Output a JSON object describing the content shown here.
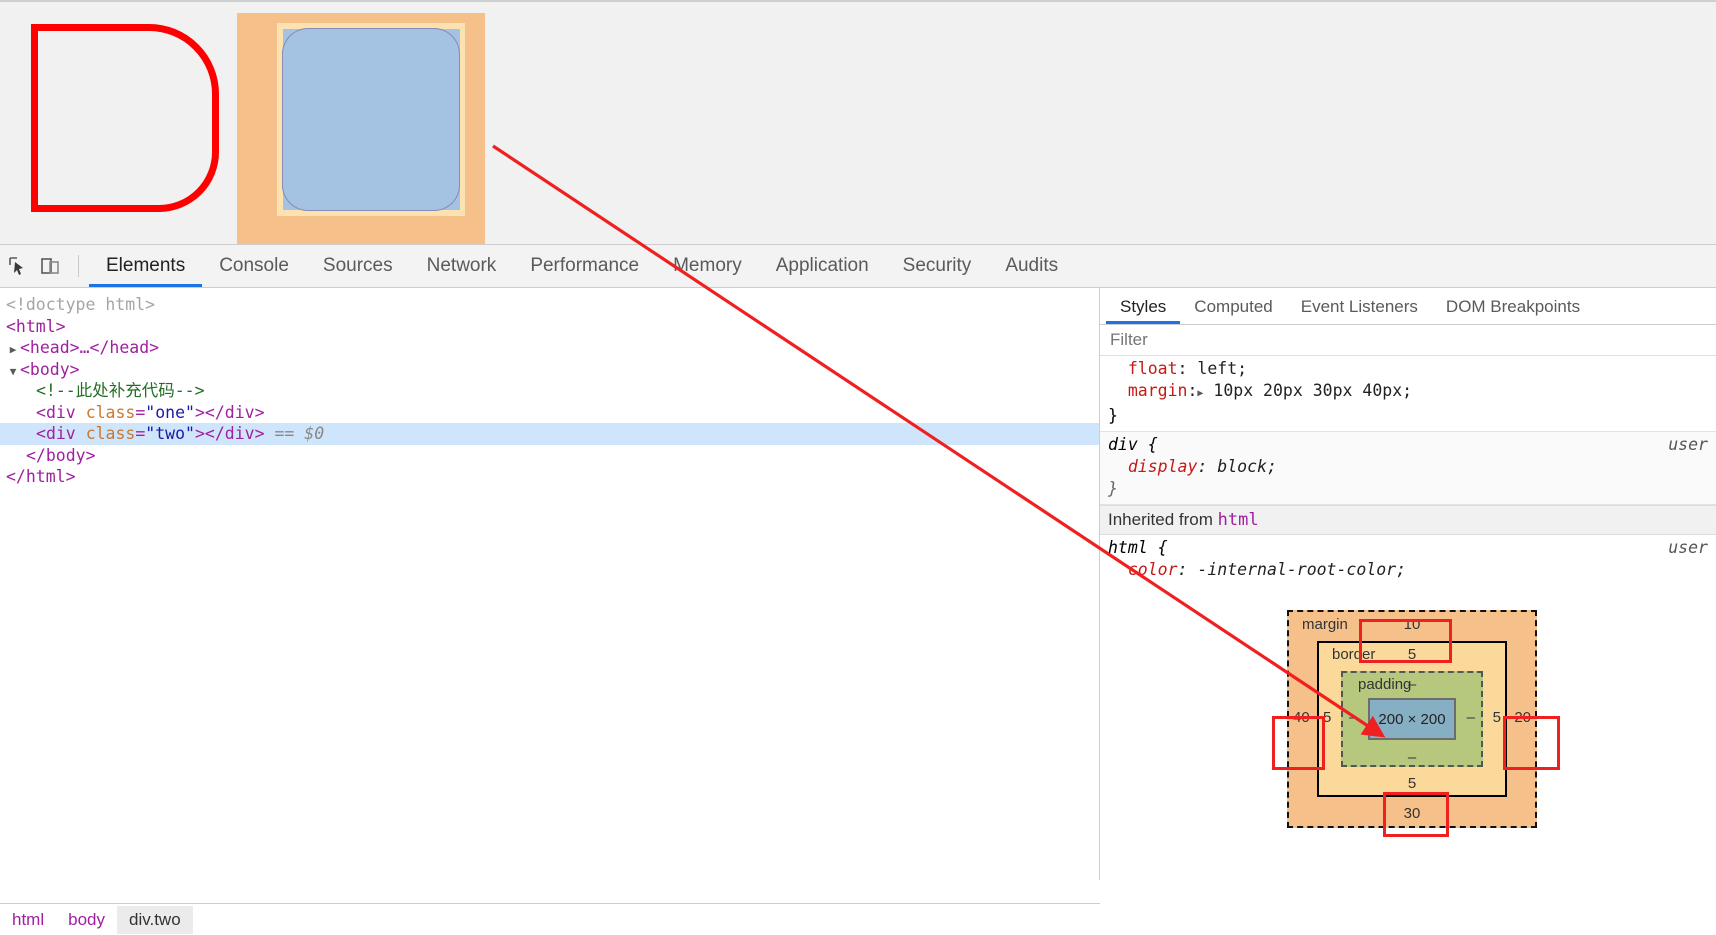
{
  "viewport": {
    "boxes": [
      {
        "name": "div-one-outline",
        "desc": "red hand-drawn rounded rectangle"
      },
      {
        "name": "div-two-highlight",
        "desc": "devtools element highlight with margin/border/padding/content overlay"
      }
    ]
  },
  "toolbar": {
    "icons": [
      {
        "name": "inspect-element-icon",
        "glyph": "⬉"
      },
      {
        "name": "device-toolbar-icon",
        "glyph": "▭"
      }
    ],
    "tabs": [
      {
        "label": "Elements",
        "active": true
      },
      {
        "label": "Console",
        "active": false
      },
      {
        "label": "Sources",
        "active": false
      },
      {
        "label": "Network",
        "active": false
      },
      {
        "label": "Performance",
        "active": false
      },
      {
        "label": "Memory",
        "active": false
      },
      {
        "label": "Application",
        "active": false
      },
      {
        "label": "Security",
        "active": false
      },
      {
        "label": "Audits",
        "active": false
      }
    ]
  },
  "dom": {
    "lines": [
      {
        "id": "doctype",
        "text": "<!doctype html>"
      },
      {
        "id": "html_open",
        "text": "<html>"
      },
      {
        "id": "head",
        "text": "<head>…</head>"
      },
      {
        "id": "body_open",
        "text": "<body>"
      },
      {
        "id": "comment",
        "text": "<!--此处补充代码-->"
      },
      {
        "id": "div_one",
        "tag": "div",
        "attr": "class",
        "value": "one"
      },
      {
        "id": "div_two",
        "tag": "div",
        "attr": "class",
        "value": "two",
        "marker": "== $0",
        "selected": true
      },
      {
        "id": "body_close",
        "text": "</body>"
      },
      {
        "id": "html_close",
        "text": "</html>"
      }
    ]
  },
  "styles": {
    "tabs": [
      {
        "label": "Styles",
        "active": true
      },
      {
        "label": "Computed",
        "active": false
      },
      {
        "label": "Event Listeners",
        "active": false
      },
      {
        "label": "DOM Breakpoints",
        "active": false
      }
    ],
    "filter_placeholder": "Filter",
    "rules": [
      {
        "id": "truncated-rule",
        "selector": "",
        "origin": "",
        "declarations": [
          {
            "property": "float",
            "value": "left;"
          },
          {
            "property": "margin",
            "value": "10px 20px 30px 40px;",
            "has_expander": true
          }
        ],
        "close": "}"
      },
      {
        "id": "div-rule",
        "selector": "div {",
        "origin": "user",
        "declarations": [
          {
            "property": "display",
            "value": "block;"
          }
        ],
        "close": "}"
      }
    ],
    "inherited_label": "Inherited from",
    "inherited_from": "html",
    "inherited_rule": {
      "selector": "html {",
      "origin": "user",
      "declarations": [
        {
          "property": "color",
          "value": "-internal-root-color;"
        }
      ],
      "close": "}"
    }
  },
  "box_model": {
    "margin_label": "margin",
    "border_label": "border",
    "padding_label": "padding",
    "content_size": "200 × 200",
    "margin_top": "10",
    "margin_right": "20",
    "margin_bottom": "30",
    "margin_left": "40",
    "border_top": "5",
    "border_right": "5",
    "border_bottom": "5",
    "border_left": "5",
    "padding_top": "–",
    "padding_right": "–",
    "padding_bottom": "–",
    "padding_left": "–",
    "colors": {
      "margin": "#f5c08a",
      "border": "#fbd99a",
      "padding": "#b5c87e",
      "content": "#86afc4",
      "annotation": "#f02020"
    }
  },
  "breadcrumb": {
    "items": [
      {
        "label": "html",
        "active": false
      },
      {
        "label": "body",
        "active": false
      },
      {
        "label": "div.two",
        "active": true
      }
    ]
  }
}
